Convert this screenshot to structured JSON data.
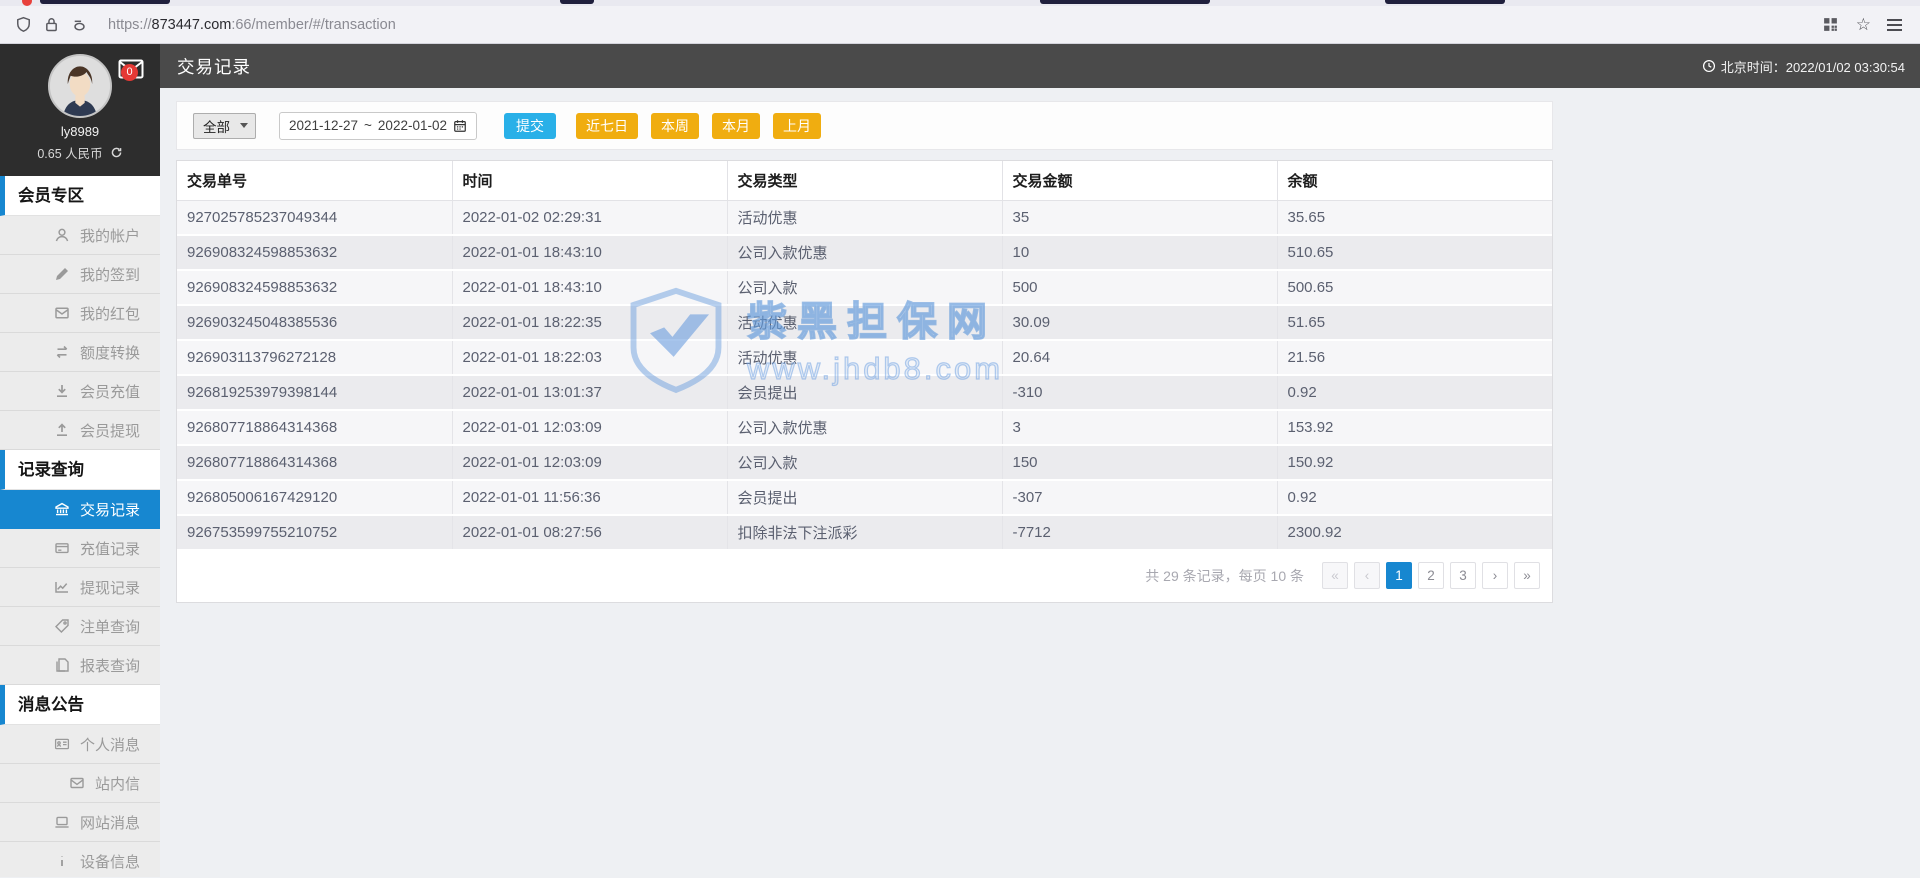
{
  "browser": {
    "url_scheme": "https://",
    "url_domain": "873447.com",
    "url_path": ":66/member/#/transaction"
  },
  "sidebar": {
    "username": "ly8989",
    "balance": "0.65 人民币",
    "badge_count": "0",
    "sections": [
      {
        "type": "header",
        "label": "会员专区"
      },
      {
        "type": "item",
        "icon": "user-icon",
        "label": "我的帐户"
      },
      {
        "type": "item",
        "icon": "pencil-icon",
        "label": "我的签到"
      },
      {
        "type": "item",
        "icon": "red-packet-icon",
        "label": "我的红包"
      },
      {
        "type": "item",
        "icon": "exchange-icon",
        "label": "额度转换"
      },
      {
        "type": "item",
        "icon": "deposit-icon",
        "label": "会员充值"
      },
      {
        "type": "item",
        "icon": "withdraw-icon",
        "label": "会员提现"
      },
      {
        "type": "header",
        "label": "记录查询"
      },
      {
        "type": "item",
        "icon": "bank-icon",
        "label": "交易记录",
        "active": true
      },
      {
        "type": "item",
        "icon": "card-icon",
        "label": "充值记录"
      },
      {
        "type": "item",
        "icon": "chart-icon",
        "label": "提现记录"
      },
      {
        "type": "item",
        "icon": "tags-icon",
        "label": "注单查询"
      },
      {
        "type": "item",
        "icon": "report-icon",
        "label": "报表查询"
      },
      {
        "type": "header",
        "label": "消息公告"
      },
      {
        "type": "item",
        "icon": "idcard-icon",
        "label": "个人消息"
      },
      {
        "type": "item",
        "icon": "mail-icon",
        "label": "站内信"
      },
      {
        "type": "item",
        "icon": "laptop-icon",
        "label": "网站消息"
      },
      {
        "type": "item",
        "icon": "info-icon",
        "label": "设备信息"
      }
    ]
  },
  "header": {
    "title": "交易记录",
    "beijing_time": "北京时间：2022/01/02 03:30:54"
  },
  "filters": {
    "type_select": "全部",
    "date_from": "2021-12-27",
    "date_separator": "~",
    "date_to": "2022-01-02",
    "submit_label": "提交",
    "quick": [
      "近七日",
      "本周",
      "本月",
      "上月"
    ]
  },
  "table": {
    "columns": [
      "交易单号",
      "时间",
      "交易类型",
      "交易金额",
      "余额"
    ],
    "rows": [
      [
        "927025785237049344",
        "2022-01-02 02:29:31",
        "活动优惠",
        "35",
        "35.65"
      ],
      [
        "926908324598853632",
        "2022-01-01 18:43:10",
        "公司入款优惠",
        "10",
        "510.65"
      ],
      [
        "926908324598853632",
        "2022-01-01 18:43:10",
        "公司入款",
        "500",
        "500.65"
      ],
      [
        "926903245048385536",
        "2022-01-01 18:22:35",
        "活动优惠",
        "30.09",
        "51.65"
      ],
      [
        "926903113796272128",
        "2022-01-01 18:22:03",
        "活动优惠",
        "20.64",
        "21.56"
      ],
      [
        "926819253979398144",
        "2022-01-01 13:01:37",
        "会员提出",
        "-310",
        "0.92"
      ],
      [
        "926807718864314368",
        "2022-01-01 12:03:09",
        "公司入款优惠",
        "3",
        "153.92"
      ],
      [
        "926807718864314368",
        "2022-01-01 12:03:09",
        "公司入款",
        "150",
        "150.92"
      ],
      [
        "926805006167429120",
        "2022-01-01 11:56:36",
        "会员提出",
        "-307",
        "0.92"
      ],
      [
        "926753599755210752",
        "2022-01-01 08:27:56",
        "扣除非法下注派彩",
        "-7712",
        "2300.92"
      ]
    ]
  },
  "pagination": {
    "summary": "共 29 条记录，每页 10 条",
    "buttons": [
      "«",
      "‹",
      "1",
      "2",
      "3",
      "›",
      "»"
    ],
    "active": "1",
    "disabled": [
      "«",
      "‹"
    ]
  },
  "watermark": {
    "line1": "紫黑担保网",
    "line2": "www.jhdb8.com"
  },
  "colors": {
    "accent_blue": "#1787d0",
    "submit_blue": "#29b0e8",
    "quick_amber": "#f0ad10",
    "header_dark": "#4a4a4a",
    "badge_red": "#e53935"
  }
}
